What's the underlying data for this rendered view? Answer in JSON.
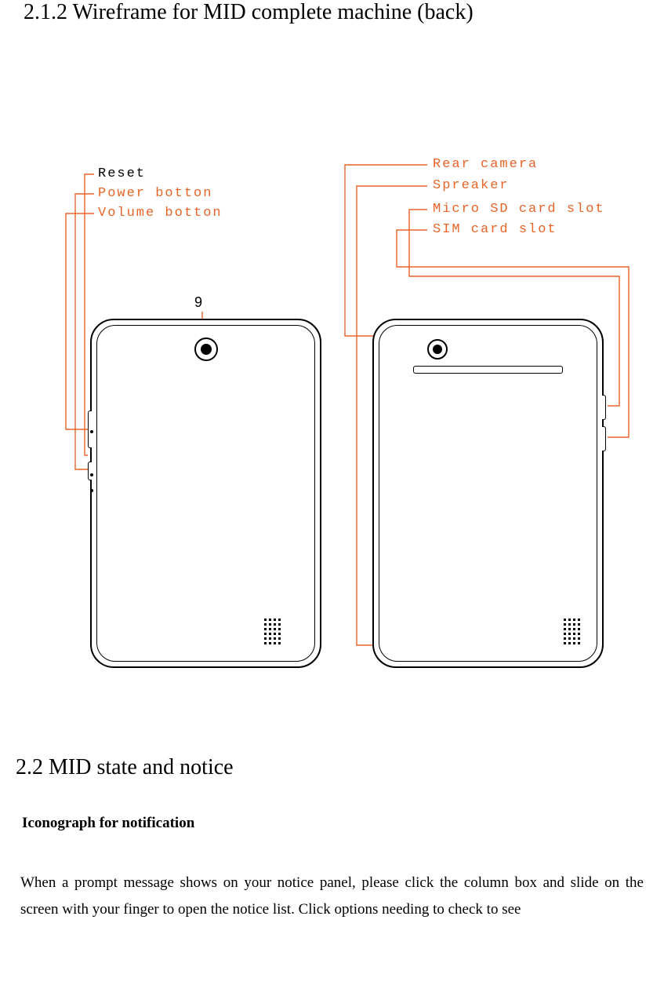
{
  "headings": {
    "h212": "2.1.2 Wireframe for MID complete machine (back)",
    "h22": "2.2 MID state and notice",
    "sub": "Iconograph for notification"
  },
  "diagram": {
    "num9": "9",
    "labels": {
      "reset": "Reset",
      "power": "Power botton",
      "volume": "Volume botton",
      "rear": "Rear camera",
      "spreaker": "Spreaker",
      "sd": "Micro SD card slot",
      "sim": "SIM card slot"
    }
  },
  "paragraph": "When a prompt message shows on your notice panel, please click the column box and slide on the screen with your finger to open the notice list. Click options needing to check to see"
}
